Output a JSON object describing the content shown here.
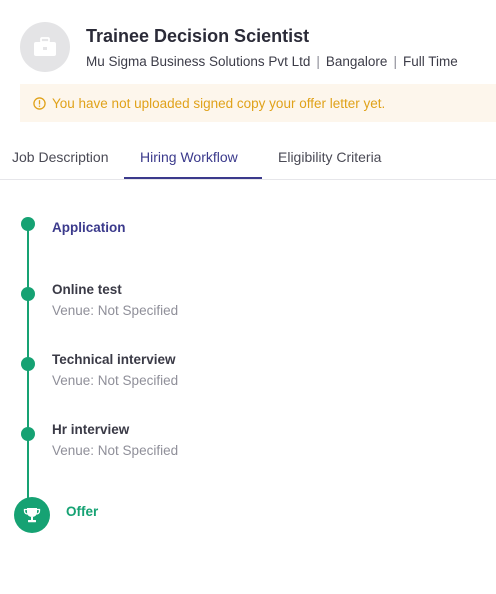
{
  "header": {
    "logo_icon": "briefcase-icon",
    "title": "Trainee Decision Scientist",
    "company": "Mu Sigma Business Solutions Pvt Ltd",
    "location": "Bangalore",
    "job_type": "Full Time",
    "separator": "|"
  },
  "alert": {
    "icon": "warning-circle-icon",
    "text": "You have not uploaded signed copy your offer letter yet.",
    "color": "#e0a21a",
    "background": "#fdf6ec"
  },
  "tabs": [
    {
      "label": "Job Description",
      "active": false
    },
    {
      "label": "Hiring Workflow",
      "active": true
    },
    {
      "label": "Eligibility Criteria",
      "active": false
    }
  ],
  "workflow": {
    "accent_color": "#16a273",
    "active_color": "#3b3a8c",
    "steps": [
      {
        "title": "Application",
        "venue": ""
      },
      {
        "title": "Online test",
        "venue": "Venue: Not Specified"
      },
      {
        "title": "Technical interview",
        "venue": "Venue: Not Specified"
      },
      {
        "title": "Hr interview",
        "venue": "Venue: Not Specified"
      }
    ],
    "final_step": {
      "title": "Offer",
      "icon": "trophy-icon"
    }
  }
}
